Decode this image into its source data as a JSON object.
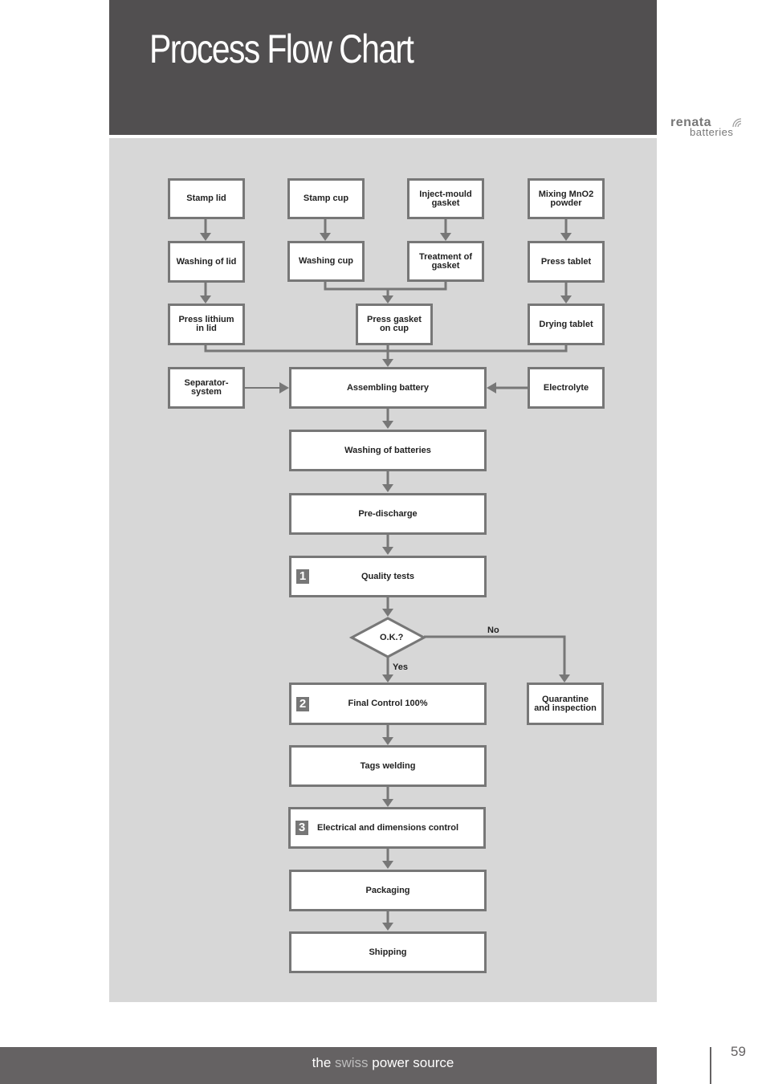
{
  "header": {
    "title": "Process Flow Chart"
  },
  "logo": {
    "brand": "renata",
    "sub": "batteries"
  },
  "flow": {
    "nodes": {
      "stamp_lid": "Stamp lid",
      "stamp_cup": "Stamp cup",
      "inject_mould_gasket": "Inject-mould\ngasket",
      "mixing_mno2": "Mixing MnO2\npowder",
      "washing_lid": "Washing of lid",
      "washing_cup": "Washing cup",
      "treatment_gasket": "Treatment of\ngasket",
      "press_tablet": "Press tablet",
      "press_lithium": "Press lithium\nin lid",
      "press_gasket": "Press gasket\non cup",
      "drying_tablet": "Drying tablet",
      "separator": "Separator-\nsystem",
      "assembling": "Assembling battery",
      "electrolyte": "Electrolyte",
      "washing_batteries": "Washing of batteries",
      "pre_discharge": "Pre-discharge",
      "quality_tests": "Quality tests",
      "decision": "O.K.?",
      "final_control": "Final Control 100%",
      "quarantine": "Quarantine\nand inspection",
      "tags_welding": "Tags welding",
      "electrical_control": "Electrical  and dimensions control",
      "packaging": "Packaging",
      "shipping": "Shipping"
    },
    "badges": {
      "quality_tests": "1",
      "final_control": "2",
      "electrical_control": "3"
    },
    "edge_labels": {
      "no": "No",
      "yes": "Yes"
    }
  },
  "footer": {
    "text_pre": "the ",
    "text_accent": "swiss",
    "text_post": " power source",
    "page_number": "59"
  }
}
